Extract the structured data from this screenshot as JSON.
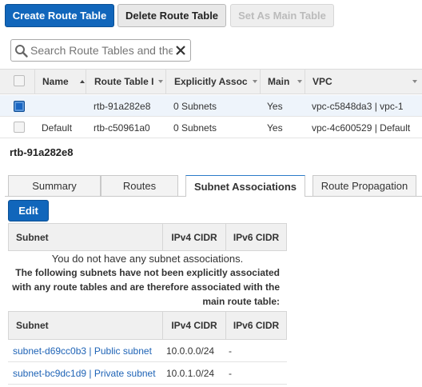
{
  "toolbar": {
    "create_label": "Create Route Table",
    "delete_label": "Delete Route Table",
    "set_main_label": "Set As Main Table"
  },
  "search": {
    "placeholder": "Search Route Tables and their properties"
  },
  "table": {
    "headers": {
      "name": "Name",
      "route_table_id": "Route Table I",
      "explicitly_assoc": "Explicitly Assoc",
      "main": "Main",
      "vpc": "VPC"
    },
    "rows": [
      {
        "selected": true,
        "name": "",
        "id": "rtb-91a282e8",
        "assoc": "0 Subnets",
        "main": "Yes",
        "vpc": "vpc-c5848da3 | vpc-1"
      },
      {
        "selected": false,
        "name": "Default",
        "id": "rtb-c50961a0",
        "assoc": "0 Subnets",
        "main": "Yes",
        "vpc": "vpc-4c600529 | Default"
      }
    ]
  },
  "detail": {
    "selected_id": "rtb-91a282e8",
    "tabs": [
      "Summary",
      "Routes",
      "Subnet Associations",
      "Route Propagation"
    ],
    "active_tab": "Subnet Associations",
    "edit_label": "Edit",
    "assoc_headers": {
      "subnet": "Subnet",
      "ipv4": "IPv4 CIDR",
      "ipv6": "IPv6 CIDR"
    },
    "no_assoc_msg": "You do not have any subnet associations.",
    "following_msg_line1": "The following subnets have not been explicitly associated",
    "following_msg_line2": "with any route tables and are therefore associated with the",
    "following_msg_line3": "main route table:",
    "subnets": [
      {
        "name": "subnet-d69cc0b3 | Public subnet",
        "ipv4": "10.0.0.0/24",
        "ipv6": "-"
      },
      {
        "name": "subnet-bc9dc1d9 | Private subnet",
        "ipv4": "10.0.1.0/24",
        "ipv6": "-"
      }
    ]
  },
  "colors": {
    "primary": "#1166bb",
    "link": "#1e63b6",
    "tab_accent": "#2b7bc9"
  },
  "icons": {
    "search": "search-icon",
    "clear": "close-icon"
  }
}
